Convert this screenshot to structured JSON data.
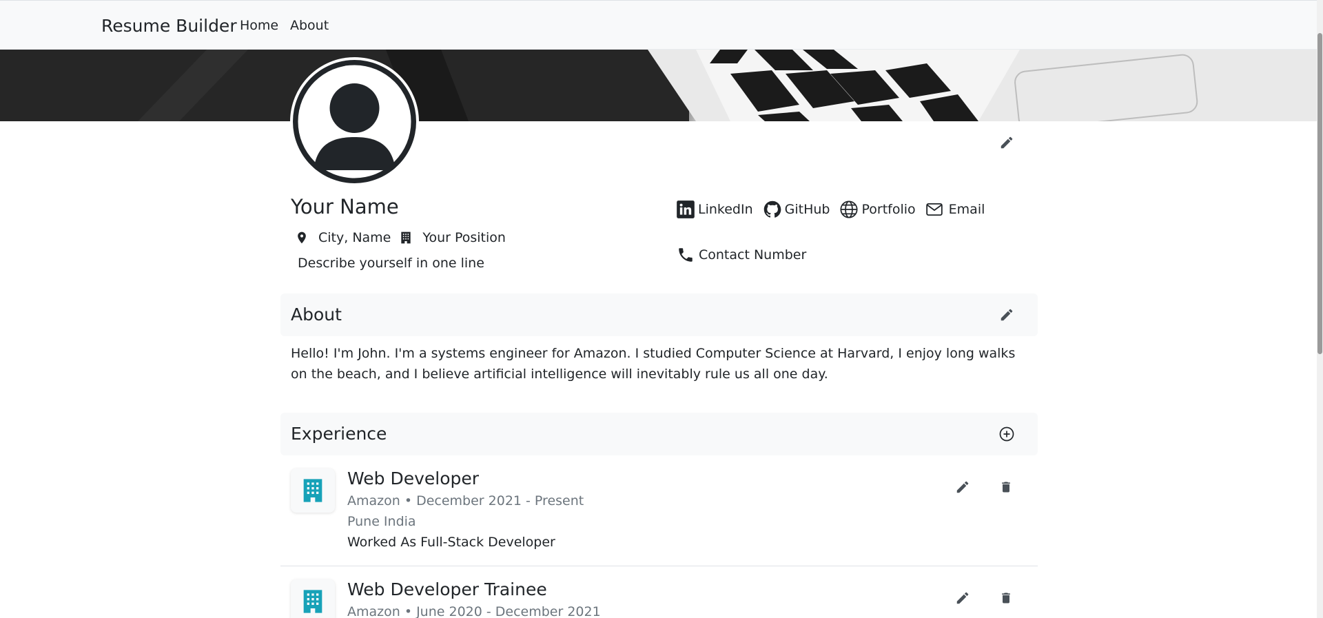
{
  "navbar": {
    "brand": "Resume Builder",
    "links": [
      "Home",
      "About"
    ]
  },
  "profile": {
    "name": "Your Name",
    "location": "City, Name",
    "position": "Your Position",
    "tagline": "Describe yourself in one line",
    "links": {
      "linkedin": "LinkedIn",
      "github": "GitHub",
      "portfolio": "Portfolio",
      "email": "Email",
      "contact": "Contact Number"
    }
  },
  "about": {
    "title": "About",
    "text": "Hello! I'm John. I'm a systems engineer for Amazon. I studied Computer Science at Harvard, I enjoy long walks on the beach, and I believe artificial intelligence will inevitably rule us all one day."
  },
  "experience": {
    "title": "Experience",
    "items": [
      {
        "role": "Web Developer",
        "company_dates": "Amazon • December 2021 - Present",
        "location": "Pune India",
        "description": "Worked As Full-Stack Developer"
      },
      {
        "role": "Web Developer Trainee",
        "company_dates": "Amazon • June 2020 - December 2021"
      }
    ]
  },
  "colors": {
    "accent": "#17a2b8",
    "text": "#212529",
    "muted": "#6c757d",
    "section_bg": "#f8f9fa",
    "icon": "#495057"
  },
  "icons": [
    "pencil-icon",
    "plus-circle-icon",
    "trash-icon",
    "building-icon",
    "map-pin-icon",
    "linkedin-icon",
    "github-icon",
    "globe-icon",
    "envelope-icon",
    "phone-icon"
  ]
}
